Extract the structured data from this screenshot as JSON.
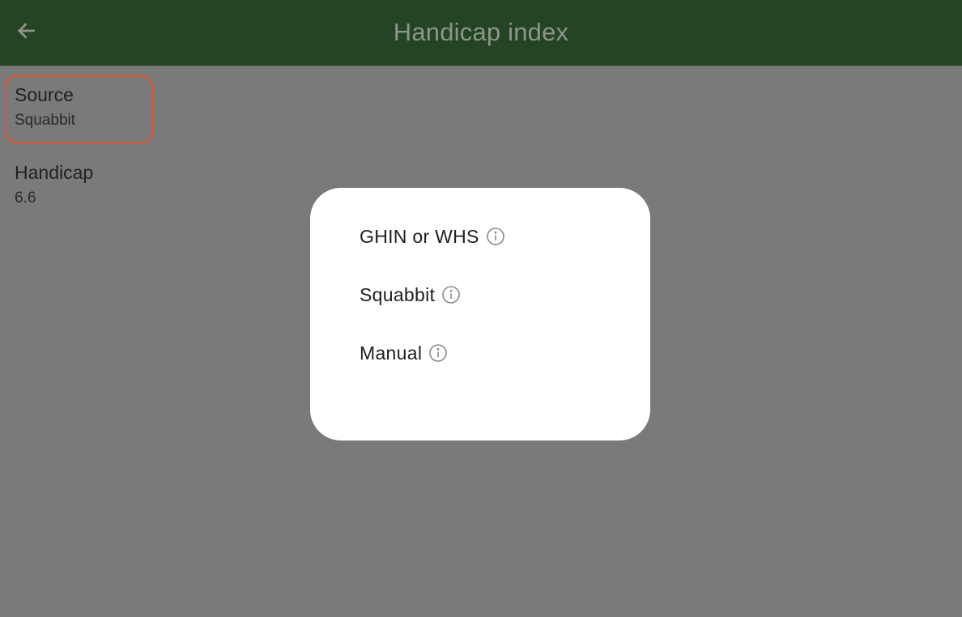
{
  "appbar": {
    "title": "Handicap index",
    "back_icon": "arrow-back-icon",
    "background": "#254423"
  },
  "settings": {
    "source": {
      "label": "Source",
      "value": "Squabbit"
    },
    "handicap": {
      "label": "Handicap",
      "value": "6.6"
    }
  },
  "highlight_color": "#e0502e",
  "dialog": {
    "options": [
      {
        "label": "GHIN or WHS",
        "icon": "info-icon"
      },
      {
        "label": "Squabbit",
        "icon": "info-icon"
      },
      {
        "label": "Manual",
        "icon": "info-icon"
      }
    ]
  }
}
